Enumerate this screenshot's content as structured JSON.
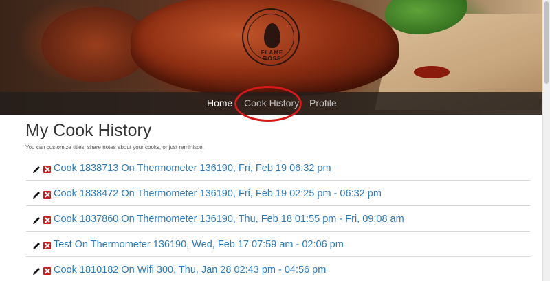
{
  "header": {
    "logo_text": "FLAME BOSS"
  },
  "nav": {
    "items": [
      {
        "label": "Home",
        "active": true
      },
      {
        "label": "Cook History",
        "active": false
      },
      {
        "label": "Profile",
        "active": false
      }
    ],
    "highlight_color": "#d81818"
  },
  "main": {
    "title": "My Cook History",
    "subtitle": "You can customize titles, share notes about your cooks, or just reminisce."
  },
  "cooks": [
    {
      "label": "Cook 1838713 On Thermometer 136190, Fri, Feb 19 06:32 pm"
    },
    {
      "label": "Cook 1838472 On Thermometer 136190, Fri, Feb 19 02:25 pm - 06:32 pm"
    },
    {
      "label": "Cook 1837860 On Thermometer 136190, Thu, Feb 18 01:55 pm - Fri, 09:08 am"
    },
    {
      "label": "Test On Thermometer 136190, Wed, Feb 17 07:59 am - 02:06 pm"
    },
    {
      "label": "Cook 1810182 On Wifi 300, Thu, Jan 28 02:43 pm - 04:56 pm"
    }
  ],
  "icons": {
    "edit": "pencil-icon",
    "delete": "delete-x-icon"
  },
  "colors": {
    "link": "#2c7bbf",
    "delete": "#cc1b1b",
    "nav_active": "#ffffff",
    "nav_inactive": "#bdbdbd"
  }
}
